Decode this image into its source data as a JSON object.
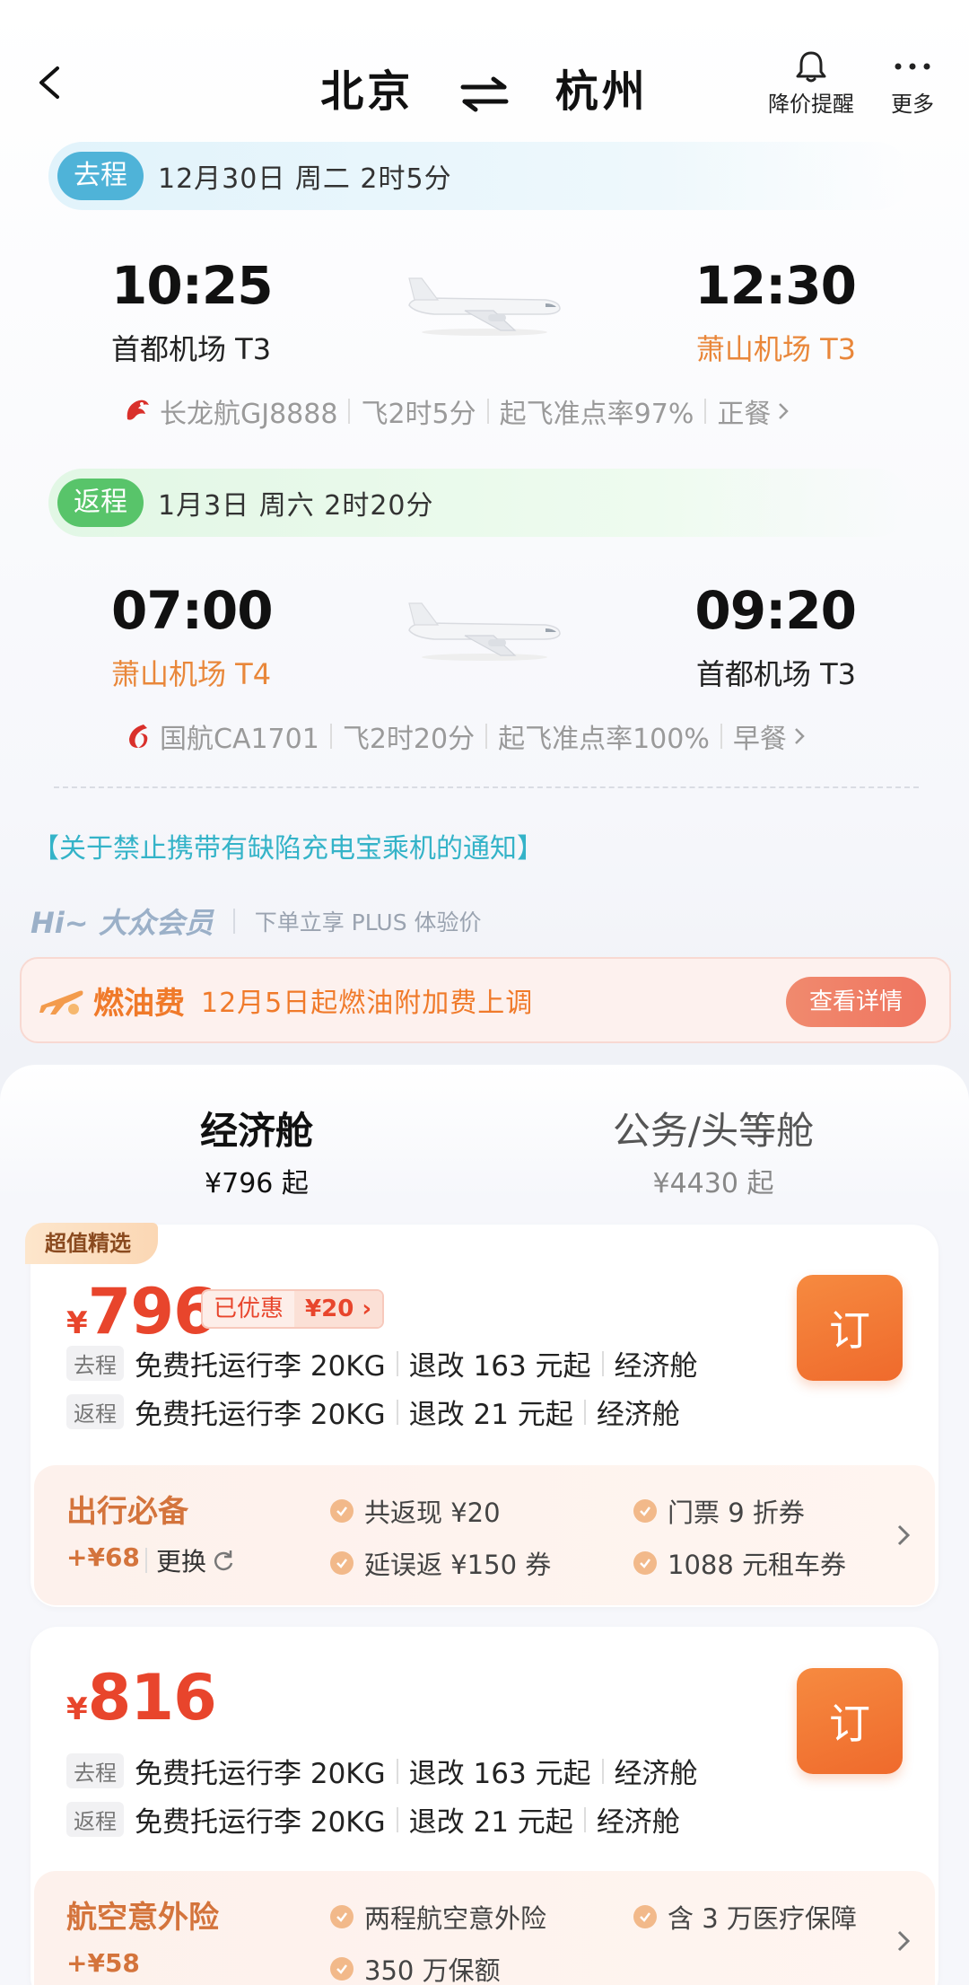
{
  "header": {
    "from_city": "北京",
    "to_city": "杭州",
    "price_alert_label": "降价提醒",
    "more_label": "更多"
  },
  "outbound": {
    "tag": "去程",
    "summary": "12月30日 周二  2时5分",
    "dep_time": "10:25",
    "dep_airport": "首都机场 T3",
    "arr_time": "12:30",
    "arr_airport": "萧山机场 T3",
    "airline_flight": "长龙航GJ8888",
    "duration": "飞2时5分",
    "ontime": "起飞准点率97%",
    "meal": "正餐"
  },
  "return": {
    "tag": "返程",
    "summary": "1月3日 周六  2时20分",
    "dep_time": "07:00",
    "dep_airport": "萧山机场 T4",
    "arr_time": "09:20",
    "arr_airport": "首都机场 T3",
    "airline_flight": "国航CA1701",
    "duration": "飞2时20分",
    "ontime": "起飞准点率100%",
    "meal": "早餐"
  },
  "notice": "【关于禁止携带有缺陷充电宝乘机的通知】",
  "member": {
    "hi": "Hi~ 大众会员",
    "plus_text": "下单立享 PLUS 体验价"
  },
  "fuel": {
    "title": "燃油费",
    "text": "12月5日起燃油附加费上调",
    "button": "查看详情"
  },
  "cabins": [
    {
      "name": "经济舱",
      "price": "¥796 起"
    },
    {
      "name": "公务/头等舱",
      "price": "¥4430 起"
    }
  ],
  "fares": [
    {
      "badge": "超值精选",
      "currency": "¥",
      "price": "796",
      "discount_label": "已优惠",
      "discount_value": "¥20 ›",
      "book_label": "订",
      "out_label": "去程",
      "out_baggage": "免费托运行李 20KG",
      "out_change": "退改 163 元起",
      "out_cabin": "经济舱",
      "ret_label": "返程",
      "ret_baggage": "免费托运行李 20KG",
      "ret_change": "退改 21 元起",
      "ret_cabin": "经济舱",
      "addon_title": "出行必备",
      "addon_price": "+¥68",
      "addon_change": "更换",
      "addon_features": [
        "共返现 ¥20",
        "门票 9 折券",
        "延误返 ¥150 券",
        "1088 元租车券"
      ]
    },
    {
      "currency": "¥",
      "price": "816",
      "book_label": "订",
      "out_label": "去程",
      "out_baggage": "免费托运行李 20KG",
      "out_change": "退改 163 元起",
      "out_cabin": "经济舱",
      "ret_label": "返程",
      "ret_baggage": "免费托运行李 20KG",
      "ret_change": "退改 21 元起",
      "ret_cabin": "经济舱",
      "addon_title": "航空意外险",
      "addon_price": "+¥58",
      "addon_features": [
        "两程航空意外险",
        "含 3 万医疗保障",
        "350 万保额"
      ]
    }
  ],
  "colors": {
    "accent_orange": "#ef6a2c",
    "price_red": "#e8452c",
    "teal": "#34b3c8"
  }
}
